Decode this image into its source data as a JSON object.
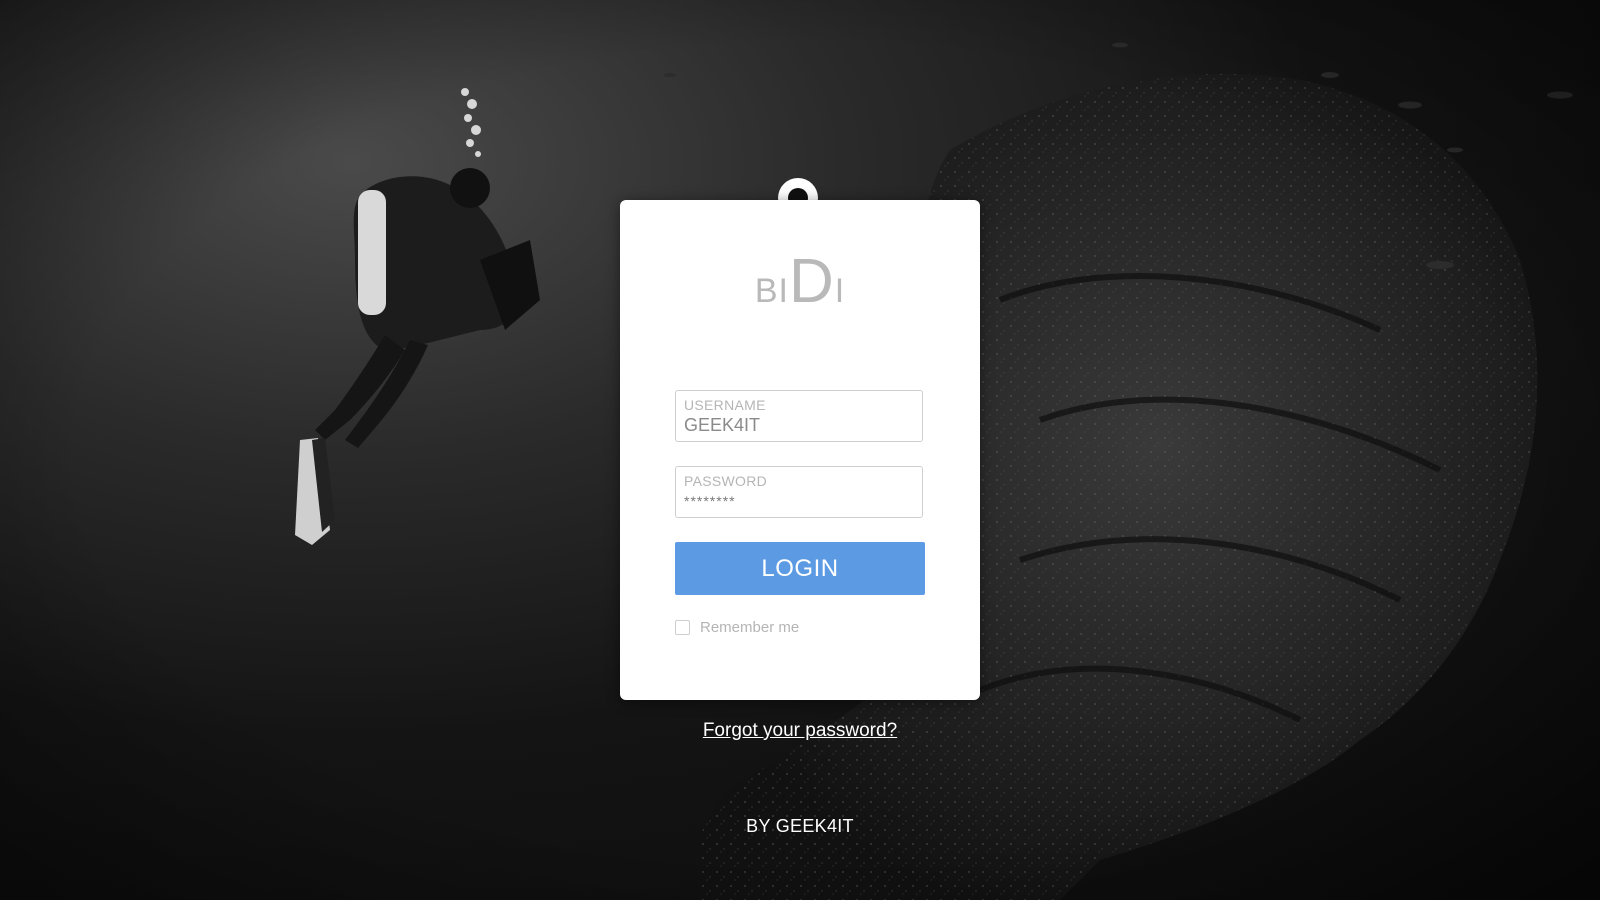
{
  "background": {
    "scene": "underwater-diver-photo",
    "tone": "black-and-white"
  },
  "logo": {
    "left": "BI",
    "center": "D",
    "right": "I"
  },
  "login_form": {
    "username": {
      "label": "USERNAME",
      "value": "GEEK4IT"
    },
    "password": {
      "label": "PASSWORD",
      "value": "********"
    },
    "login_button_label": "LOGIN",
    "remember_me": {
      "label": "Remember me",
      "checked": false
    }
  },
  "forgot_password_link": "Forgot your password?",
  "footer": {
    "credit": "BY GEEK4IT"
  },
  "colors": {
    "accent": "#5c9be3",
    "card": "#ffffff",
    "muted_text": "#b5b5b5"
  }
}
